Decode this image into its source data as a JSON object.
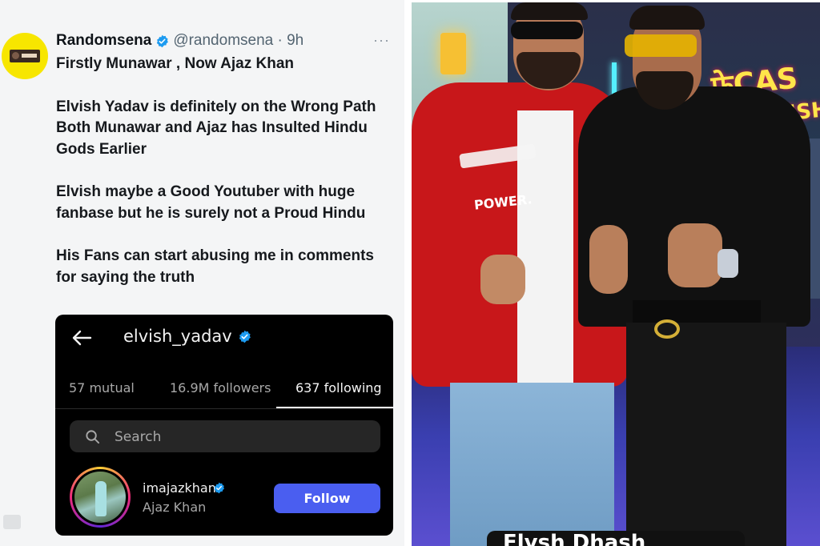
{
  "tweet": {
    "display_name": "Randomsena",
    "handle_time": "@randomsena · 9h",
    "more_menu": "···",
    "paragraphs": [
      "Firstly Munawar , Now Ajaz Khan",
      "Elvish Yadav is definitely on the Wrong Path\nBoth Munawar and Ajaz has Insulted Hindu Gods Earlier",
      "Elvish maybe a Good Youtuber with huge fanbase but he is surely not a Proud Hindu",
      "His Fans can start abusing me in comments for saying the truth"
    ]
  },
  "instagram": {
    "back_icon": "arrow-left-icon",
    "username": "elvish_yadav",
    "tabs": [
      {
        "label": "57 mutual",
        "active": false
      },
      {
        "label": "16.9M followers",
        "active": false
      },
      {
        "label": "637 following",
        "active": true
      }
    ],
    "search_placeholder": "Search",
    "result": {
      "handle": "imajazkhan",
      "name": "Ajaz Khan",
      "follow_label": "Follow"
    }
  },
  "photo": {
    "sign_line1": "फ्रेCAS",
    "sign_line2": "ELVISH",
    "left_jacket_text": "POWER.",
    "caption": "Elvsh Dhash"
  },
  "colors": {
    "verified": "#1d9bf0",
    "follow_button": "#4a5ef0",
    "jacket": "#c8171a"
  }
}
